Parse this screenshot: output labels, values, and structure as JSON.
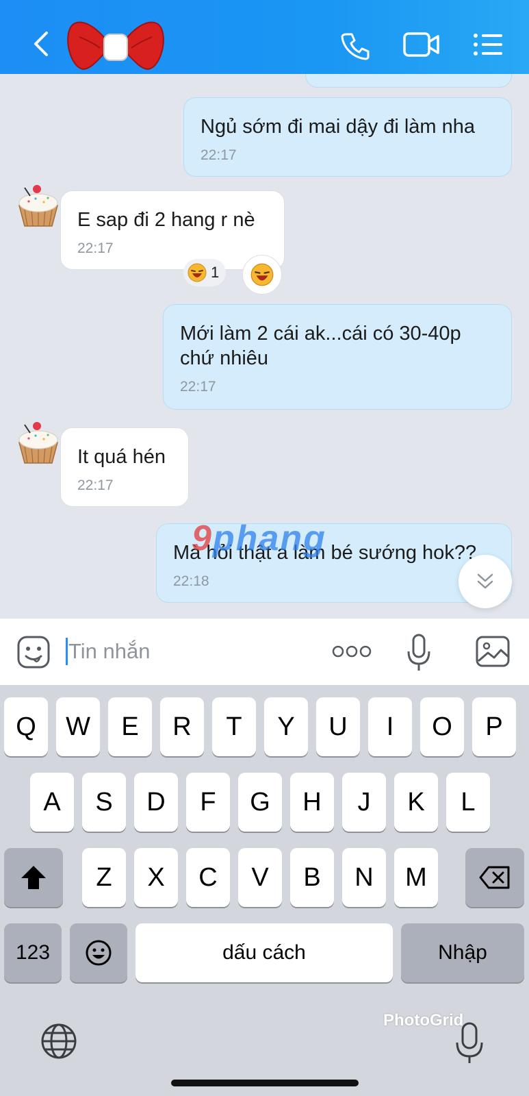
{
  "header": {
    "back_icon": "chevron-left-icon",
    "avatar_icon": "red-bow-icon",
    "actions": [
      "phone-icon",
      "video-camera-icon",
      "menu-list-icon"
    ]
  },
  "messages": [
    {
      "side": "sent",
      "text": "Ngủ sớm đi mai dậy đi làm nha",
      "time": "22:17"
    },
    {
      "side": "received",
      "text": "E sap đi 2 hang r nè",
      "time": "22:17",
      "reaction_count": "1"
    },
    {
      "side": "sent",
      "text": "Mới làm 2 cái ak...cái có 30-40p chứ nhiêu",
      "time": "22:17"
    },
    {
      "side": "received",
      "text": "It quá hén",
      "time": "22:17"
    },
    {
      "side": "sent",
      "text": "Mà hỏi thật a làm bé sướng hok??",
      "time": "22:18"
    }
  ],
  "watermark": {
    "part1": "9",
    "part2": "phang"
  },
  "input": {
    "placeholder": "Tin nhắn",
    "value": ""
  },
  "keyboard": {
    "row1": [
      "Q",
      "W",
      "E",
      "R",
      "T",
      "Y",
      "U",
      "I",
      "O",
      "P"
    ],
    "row2": [
      "A",
      "S",
      "D",
      "F",
      "G",
      "H",
      "J",
      "K",
      "L"
    ],
    "row3": [
      "Z",
      "X",
      "C",
      "V",
      "B",
      "N",
      "M"
    ],
    "numbers_label": "123",
    "space_label": "dấu cách",
    "enter_label": "Nhập"
  },
  "photogrid_label": "PhotoGrid",
  "colors": {
    "header": "#1a96f3",
    "sent_bubble": "#d4ecfb",
    "received_bubble": "#ffffff",
    "keyboard_bg": "#d3d6dc"
  }
}
